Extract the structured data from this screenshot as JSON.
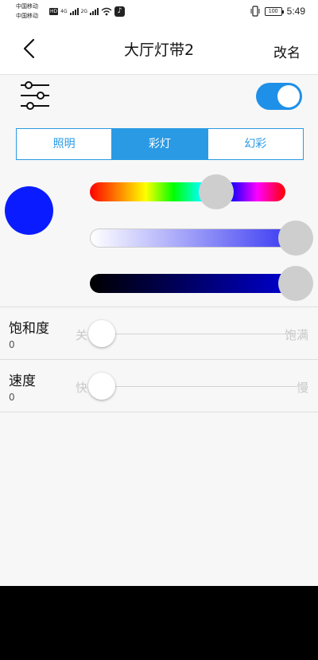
{
  "status_bar": {
    "carrier_1": "中国移动",
    "carrier_2": "中国移动",
    "hd": "HD",
    "net_1": "4G",
    "net_2": "2G",
    "battery": "100",
    "time": "5:49"
  },
  "header": {
    "title": "大厅灯带2",
    "rename_label": "改名"
  },
  "power": {
    "on": true
  },
  "mode_tabs": [
    {
      "label": "照明",
      "active": false
    },
    {
      "label": "彩灯",
      "active": true
    },
    {
      "label": "幻彩",
      "active": false
    }
  ],
  "color": {
    "preview": "#0a1cff",
    "hue_level": 0.66,
    "white_level": 1.0,
    "brightness_level": 1.0
  },
  "params": [
    {
      "name": "饱和度",
      "value": "0",
      "min_label": "关",
      "max_label": "饱满",
      "level": 0.0
    },
    {
      "name": "速度",
      "value": "0",
      "min_label": "快",
      "max_label": "慢",
      "level": 0.0
    }
  ],
  "colors": {
    "accent": "#2a9ae4",
    "toggle_on": "#1e90e8",
    "thumb": "#cecece"
  },
  "icons": [
    "back-chevron-icon",
    "settings-sliders-icon",
    "tiktok-icon",
    "vibrate-icon",
    "wifi-icon"
  ]
}
